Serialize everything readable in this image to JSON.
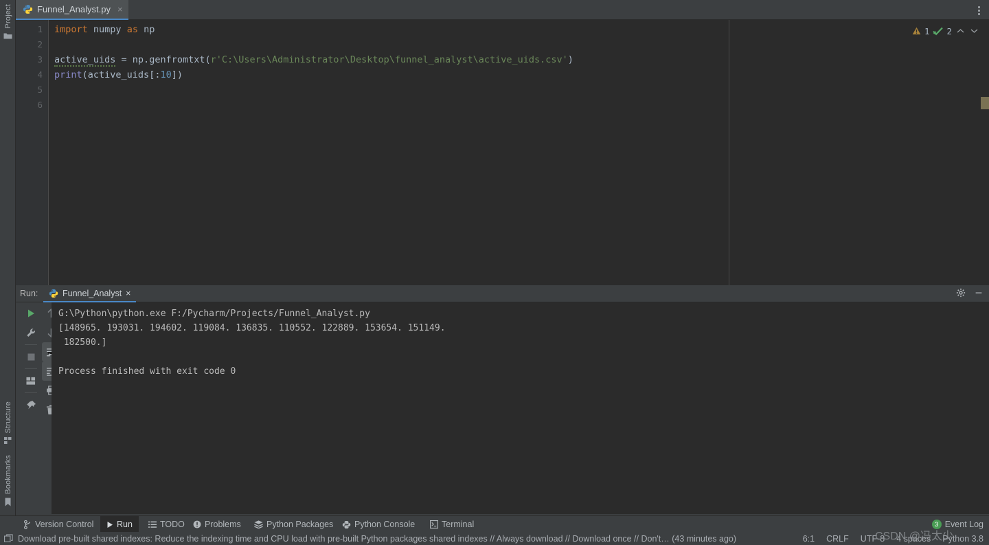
{
  "window": {
    "title": "Funnel_Analyst.py"
  },
  "left_strip": {
    "top_items": [
      {
        "label": "Project",
        "icon": "folder-icon"
      }
    ],
    "bottom_items": [
      {
        "label": "Structure",
        "icon": "structure-icon"
      },
      {
        "label": "Bookmarks",
        "icon": "bookmark-icon"
      }
    ]
  },
  "tabs": {
    "items": [
      {
        "label": "Funnel_Analyst.py",
        "icon": "python-file-icon",
        "close": "×",
        "active": true
      }
    ],
    "overflow_menu_icon": "more-vertical-icon"
  },
  "editor": {
    "line_numbers": [
      "1",
      "2",
      "3",
      "4",
      "5",
      "6"
    ],
    "current_line": 6,
    "code": {
      "line1": {
        "kw1": "import",
        "id1": " numpy ",
        "kw2": "as",
        "id2": " np"
      },
      "line3": {
        "id": "active_uids",
        "eq": " = ",
        "obj": "np.",
        "fn": "genfromtxt",
        "paren_open": "(",
        "prefix": "r",
        "string": "'C:\\Users\\Administrator\\Desktop\\funnel_analyst\\active_uids.csv'",
        "paren_close": ")"
      },
      "line4": {
        "fn": "print",
        "paren_open": "(",
        "id": "active_uids",
        "bracket_open": "[",
        "colon": ":",
        "num": "10",
        "bracket_close": "]",
        "paren_close": ")"
      }
    },
    "inspections": {
      "warning_icon": "warning-triangle-icon",
      "warning_count": "1",
      "ok_icon": "inspection-ok-icon",
      "ok_count": "2",
      "prev_icon": "chevron-up-icon",
      "next_icon": "chevron-down-icon"
    }
  },
  "run_window": {
    "label": "Run:",
    "tab": {
      "label": "Funnel_Analyst",
      "icon": "python-config-icon",
      "close": "×"
    },
    "header_icons": [
      {
        "name": "settings-gear-icon"
      },
      {
        "name": "minimize-icon"
      }
    ],
    "toolbar_left": [
      {
        "name": "rerun-button",
        "icon": "play-icon"
      },
      {
        "name": "edit-configurations-button",
        "icon": "wrench-icon"
      },
      {
        "name": "stop-button",
        "icon": "stop-icon"
      },
      {
        "name": "layout-settings-button",
        "icon": "layout-icon"
      },
      {
        "name": "pin-tab-button",
        "icon": "pin-icon"
      }
    ],
    "toolbar_right": [
      {
        "name": "up-the-stack-trace-button",
        "icon": "arrow-up-icon"
      },
      {
        "name": "down-the-stack-trace-button",
        "icon": "arrow-down-icon"
      },
      {
        "name": "soft-wrap-button",
        "icon": "soft-wrap-icon",
        "selected": true
      },
      {
        "name": "scroll-to-end-button",
        "icon": "scroll-to-end-icon",
        "selected": true
      },
      {
        "name": "print-button",
        "icon": "printer-icon"
      },
      {
        "name": "clear-all-button",
        "icon": "trash-icon"
      }
    ],
    "console_lines": [
      "G:\\Python\\python.exe F:/Pycharm/Projects/Funnel_Analyst.py",
      "[148965. 193031. 194602. 119084. 136835. 110552. 122889. 153654. 151149.",
      " 182500.]",
      "",
      "Process finished with exit code 0"
    ]
  },
  "bottom_bar": {
    "items": [
      {
        "label": "Version Control",
        "icon": "branch-icon",
        "active": false
      },
      {
        "label": "Run",
        "icon": "play-icon",
        "active": true
      },
      {
        "label": "TODO",
        "icon": "list-icon",
        "active": false
      },
      {
        "label": "Problems",
        "icon": "problems-icon",
        "active": false
      },
      {
        "label": "Python Packages",
        "icon": "packages-icon",
        "active": false
      },
      {
        "label": "Python Console",
        "icon": "python-console-icon",
        "active": false
      },
      {
        "label": "Terminal",
        "icon": "terminal-icon",
        "active": false
      }
    ],
    "event_log": {
      "label": "Event Log",
      "count": "3"
    }
  },
  "status_bar": {
    "notification_icon": "window-icon",
    "notification": "Download pre-built shared indexes: Reduce the indexing time and CPU load with pre-built Python packages shared indexes // Always download // Download once // Don't… (43 minutes ago)",
    "caret_position": "6:1",
    "line_separator": "CRLF",
    "encoding": "UTF-8",
    "indent": "4 spaces",
    "interpreter": "Python 3.8"
  },
  "watermark": {
    "text": "CSDN @冯太少"
  },
  "colors": {
    "background": "#3c3f41",
    "editor_bg": "#2b2b2b",
    "gutter_bg": "#313335",
    "accent_blue": "#4a88c7",
    "keyword_orange": "#cc7832",
    "string_green": "#6a8759",
    "number_blue": "#6897bb",
    "function_yellow": "#ffc66d",
    "green_badge": "#499c54",
    "scrollbar_marker": "#7a7254"
  }
}
